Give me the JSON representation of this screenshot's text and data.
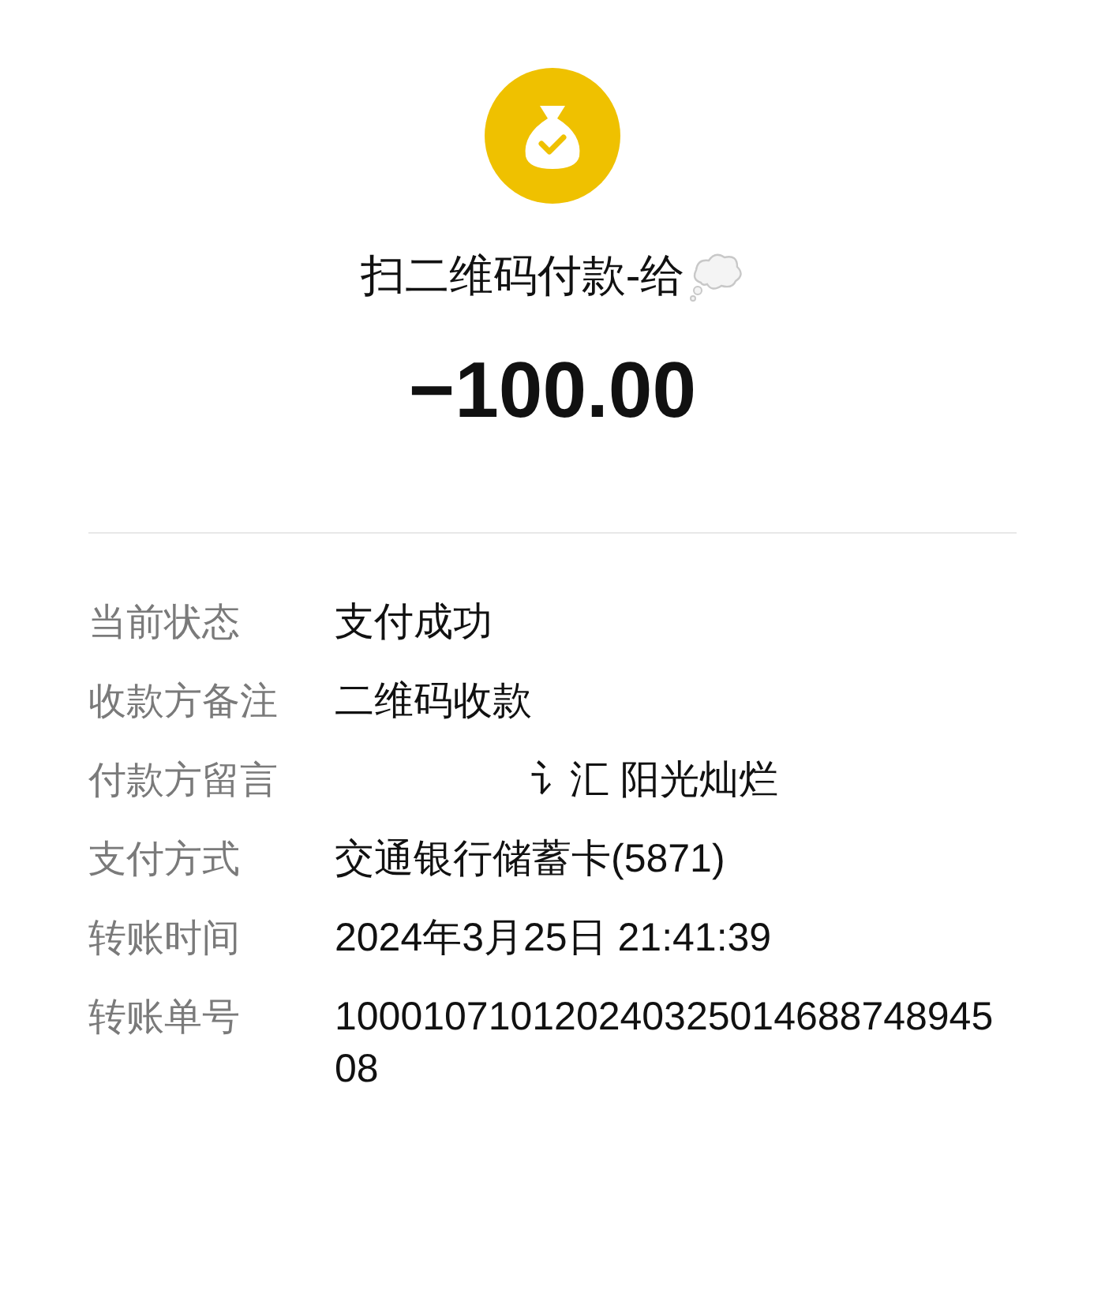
{
  "header": {
    "title": "扫二维码付款-给",
    "amount": "−100.00"
  },
  "details": [
    {
      "label": "当前状态",
      "value": "支付成功",
      "kind": "plain"
    },
    {
      "label": "收款方备注",
      "value": "二维码收款",
      "kind": "plain"
    },
    {
      "label": "付款方留言",
      "value": "讠汇 阳光灿烂",
      "kind": "indented"
    },
    {
      "label": "支付方式",
      "value": "交通银行储蓄卡(5871)",
      "kind": "plain"
    },
    {
      "label": "转账时间",
      "value": "2024年3月25日 21:41:39",
      "kind": "plain"
    },
    {
      "label": "转账单号",
      "value": "10001071012024032501468874894508",
      "kind": "plain"
    }
  ]
}
